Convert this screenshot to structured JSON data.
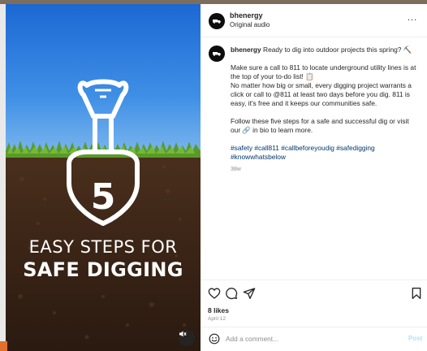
{
  "header": {
    "username": "bhenergy",
    "audio_label": "Original audio",
    "more_label": "..."
  },
  "media": {
    "number": "5",
    "caption_line1": "EASY STEPS FOR",
    "caption_line2": "SAFE DIGGING"
  },
  "post": {
    "username": "bhenergy",
    "intro": " Ready to dig into outdoor projects this spring? ⛏️",
    "paragraph1": "Make sure a call to 811 to locate underground utility lines is at the top of your to-do list! 📋",
    "paragraph2": "No matter how big or small, every digging project warrants a click or call to @811 at least two days before you dig. 811 is easy, it's free and it keeps our communities safe.",
    "paragraph3": "Follow these five steps for a safe and successful dig or visit our 🔗 in bio to learn more.",
    "hashtags": "#safety #call811 #callbeforeyoudig #safedigging #knowwhatsbelow",
    "age": "38w"
  },
  "engagement": {
    "likes": "8 likes",
    "date": "April 12"
  },
  "comment": {
    "placeholder": "Add a comment...",
    "post_label": "Post"
  },
  "colors": {
    "link": "#00376b",
    "post_button": "#b2dffc",
    "sky_top": "#1f6fd8",
    "soil": "#3b2417"
  }
}
